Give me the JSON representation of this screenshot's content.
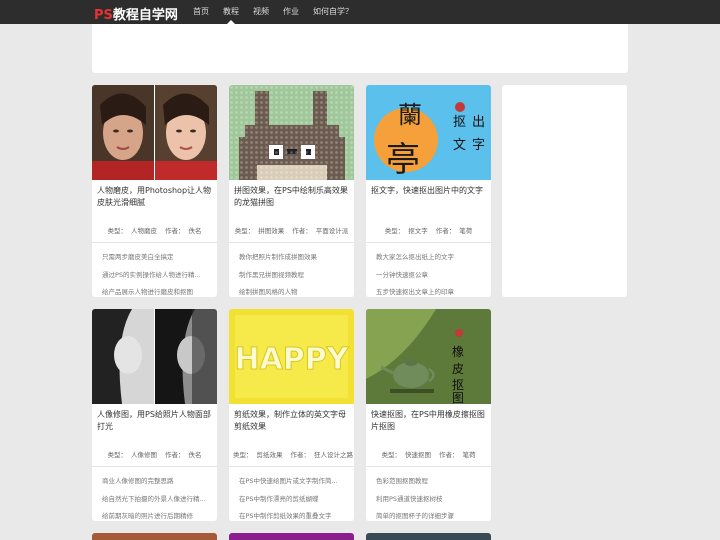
{
  "logo": {
    "ps": "PS",
    "rest": "教程自学网"
  },
  "nav": [
    {
      "label": "首页"
    },
    {
      "label": "教程"
    },
    {
      "label": "视频"
    },
    {
      "label": "作业"
    },
    {
      "label": "如何自学？"
    }
  ],
  "meta_labels": {
    "type": "类型：",
    "author": "作者："
  },
  "cards": [
    {
      "title": "人物磨皮，用Photoshop让人物皮肤光滑细腻",
      "type": "人物磨皮",
      "author": "佚名",
      "links": [
        "只需两步磨皮美白全搞定",
        "通过PS的实例操作给人物进行精...",
        "给产品展示人物进行磨皮和抠图"
      ]
    },
    {
      "title": "拼图效果，在PS中绘制乐高效果的龙猫拼图",
      "type": "拼图效果",
      "author": "平面设计派",
      "links": [
        "教你把照片制作成拼图效果",
        "制作黑兄拼图视频教程",
        "绘制拼图风格的人物"
      ]
    },
    {
      "title": "抠文字，快速抠出图片中的文字",
      "type": "抠文字",
      "author": "笔荷",
      "links": [
        "教大家怎么抠出纸上的文字",
        "一分钟快速抠公章",
        "五步快速抠出文章上的印章"
      ]
    },
    {
      "title": "人像修图，用PS给照片人物面部打光",
      "type": "人像修图",
      "author": "佚名",
      "links": [
        "商业人像修图的完整思路",
        "给自然光下拍摄的外景人像进行精...",
        "给前期灰暗的照片进行后期精修"
      ]
    },
    {
      "title": "剪纸效果，制作立体的英文字母剪纸效果",
      "type": "剪纸效果",
      "author": "狂人设计之路",
      "links": [
        "在PS中快速给图片或文字制作简...",
        "在PS中制作漂亮的剪纸蝴蝶",
        "在PS中制作剪纸效果的重叠文字"
      ]
    },
    {
      "title": "快速抠图，在PS中用橡皮擦抠图片抠图",
      "type": "快速抠图",
      "author": "笔荷",
      "links": [
        "色彩范围抠图教程",
        "利用PS通道快速抠树枝",
        "简单的抠图杯子的详细步骤"
      ]
    }
  ],
  "thumb_text": {
    "lan": "蘭",
    "ting": "亭",
    "kou": "抠",
    "chu": "出",
    "wen": "文",
    "zi": "字",
    "happy": "HAPPY",
    "xiang": "橡",
    "pi": "皮",
    "kou2": "抠",
    "tu": "图"
  },
  "colors": {
    "topbar": "#2d2d2d",
    "accent": "#e63232",
    "yellow": "#f2e032",
    "green": "#5e7a3a",
    "sky": "#5cc0ec"
  }
}
